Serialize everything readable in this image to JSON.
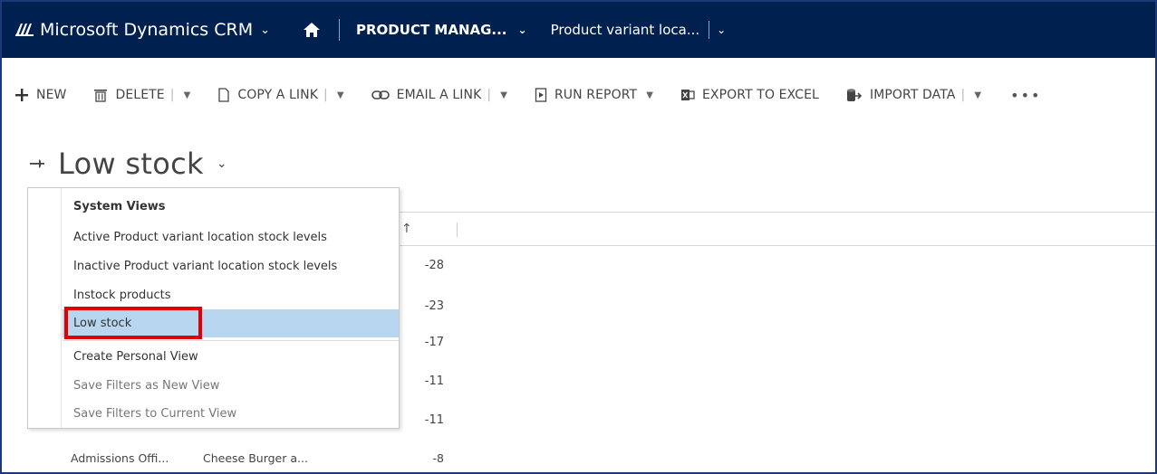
{
  "topbar": {
    "brand": "Microsoft Dynamics CRM",
    "brand_chevron": "⌄",
    "area": "PRODUCT MANAG...",
    "area_chevron": "⌄",
    "entity": "Product variant loca...",
    "entity_chevron": "⌄",
    "bg_color": "#002050"
  },
  "commands": {
    "new": "NEW",
    "delete": "DELETE",
    "copy_link": "COPY A LINK",
    "email_link": "EMAIL A LINK",
    "run_report": "RUN REPORT",
    "export_excel": "EXPORT TO EXCEL",
    "import_data": "IMPORT DATA",
    "more": "•••"
  },
  "view": {
    "title": "Low stock",
    "chevron": "⌄"
  },
  "grid": {
    "sort_indicator": "↑",
    "quantities": [
      "-28",
      "-23",
      "-17",
      "-11",
      "-11",
      "-8"
    ],
    "last_row": {
      "col1": "Admissions Offi...",
      "col2": "Cheese Burger a...",
      "qty": "-8"
    }
  },
  "view_menu": {
    "system_views_header": "System Views",
    "items": [
      "Active Product variant location stock levels",
      "Inactive Product variant location stock levels",
      "Instock products",
      "Low stock"
    ],
    "selected": "Low stock",
    "create_personal": "Create Personal View",
    "save_new": "Save Filters as New View",
    "save_current": "Save Filters to Current View",
    "selected_color": "#b8d6ef",
    "highlight_color": "#e00000"
  }
}
